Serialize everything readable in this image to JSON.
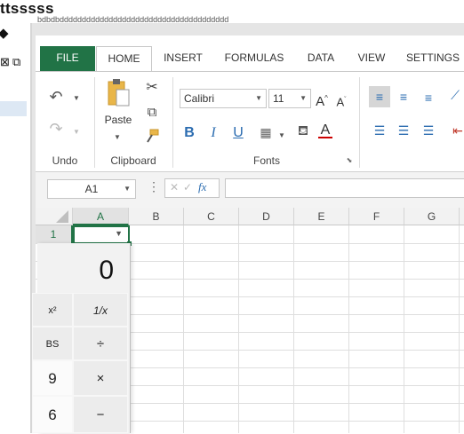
{
  "window": {
    "title": "ttsssss",
    "subtitle_strip": "bdbdbdddddddddddddddddddddddddddddddddddddddddddd"
  },
  "left_panel": {
    "icons": [
      "diamond-icon",
      "close-box-icon",
      "restore-icon"
    ]
  },
  "ribbon": {
    "tabs": [
      "FILE",
      "HOME",
      "INSERT",
      "FORMULAS",
      "DATA",
      "VIEW",
      "SETTINGS"
    ],
    "active_tab": "HOME",
    "groups": {
      "undo": {
        "label": "Undo"
      },
      "clipboard": {
        "label": "Clipboard",
        "paste_label": "Paste"
      },
      "fonts": {
        "label": "Fonts",
        "font_name": "Calibri",
        "font_size": "11"
      }
    }
  },
  "formula_bar": {
    "name_box": "A1",
    "fx_label": "fx",
    "formula": ""
  },
  "grid": {
    "columns": [
      "A",
      "B",
      "C",
      "D",
      "E",
      "F",
      "G"
    ],
    "rows": [
      "1"
    ],
    "selected_cell": "A1"
  },
  "calculator": {
    "display": "0",
    "keys": [
      [
        "x²",
        "1/x"
      ],
      [
        "BS",
        "÷"
      ],
      [
        "9",
        "×"
      ],
      [
        "6",
        "−"
      ]
    ]
  },
  "colors": {
    "file_tab": "#217346",
    "accent": "#217346",
    "blue_icon": "#2b6cb0"
  }
}
